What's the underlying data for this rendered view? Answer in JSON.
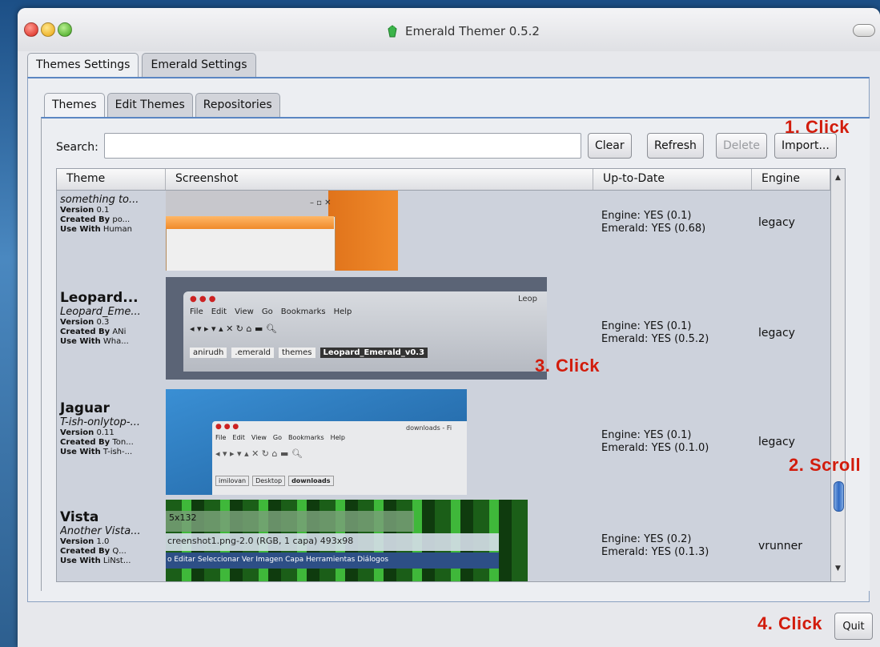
{
  "window": {
    "title": "Emerald Themer 0.5.2"
  },
  "outer_tabs": [
    {
      "label": "Themes Settings"
    },
    {
      "label": "Emerald Settings"
    }
  ],
  "inner_tabs": [
    {
      "label": "Themes"
    },
    {
      "label": "Edit Themes"
    },
    {
      "label": "Repositories"
    }
  ],
  "search": {
    "label": "Search:",
    "value": "",
    "placeholder": ""
  },
  "buttons": {
    "clear": "Clear",
    "refresh": "Refresh",
    "delete": "Delete",
    "import": "Import...",
    "quit": "Quit"
  },
  "columns": [
    "Theme",
    "Screenshot",
    "Up-to-Date",
    "Engine"
  ],
  "themes": [
    {
      "name": "",
      "desc": "something to...",
      "version": "0.1",
      "created_by": "po...",
      "use_with": "Human",
      "engine_status": "Engine: YES (0.1)",
      "emerald_status": "Emerald: YES (0.68)",
      "engine": "legacy"
    },
    {
      "name": "Leopard...",
      "desc": "Leopard_Eme...",
      "version": "0.3",
      "created_by": "ANi",
      "use_with": "Wha...",
      "engine_status": "Engine: YES (0.1)",
      "emerald_status": "Emerald: YES (0.5.2)",
      "engine": "legacy"
    },
    {
      "name": "Jaguar",
      "desc": "T-ish-onlytop-...",
      "version": "0.11",
      "created_by": "Ton...",
      "use_with": "T-ish-...",
      "engine_status": "Engine: YES (0.1)",
      "emerald_status": "Emerald: YES (0.1.0)",
      "engine": "legacy"
    },
    {
      "name": "Vista",
      "desc": "Another Vista...",
      "version": "1.0",
      "created_by": "Q...",
      "use_with": "LiNst...",
      "engine_status": "Engine: YES (0.2)",
      "emerald_status": "Emerald: YES (0.1.3)",
      "engine": "vrunner"
    }
  ],
  "meta_labels": {
    "version": "Version",
    "created_by": "Created By",
    "use_with": "Use With"
  },
  "annotations": [
    "1. Click",
    "2. Scroll",
    "3. Click",
    "4. Click"
  ],
  "thumb_text": {
    "leopard_menu": [
      "File",
      "Edit",
      "View",
      "Go",
      "Bookmarks",
      "Help"
    ],
    "leopard_path": [
      "anirudh",
      ".emerald",
      "themes",
      "Leopard_Emerald_v0.3"
    ],
    "leopard_title": "Leop",
    "jaguar_title": "downloads - Fi",
    "jaguar_menu": [
      "File",
      "Edit",
      "View",
      "Go",
      "Bookmarks",
      "Help"
    ],
    "jaguar_path": [
      "imilovan",
      "Desktop",
      "downloads"
    ],
    "vista_lines": [
      "5x132",
      "creenshot1.png-2.0 (RGB, 1 capa) 493x98",
      "o  Editar  Seleccionar  Ver  Imagen  Capa  Herramientas  Diálogos"
    ]
  },
  "colors": {
    "accent": "#5b86c2",
    "annotation": "#d21c0c",
    "row_bg": "#cdd2dc"
  }
}
